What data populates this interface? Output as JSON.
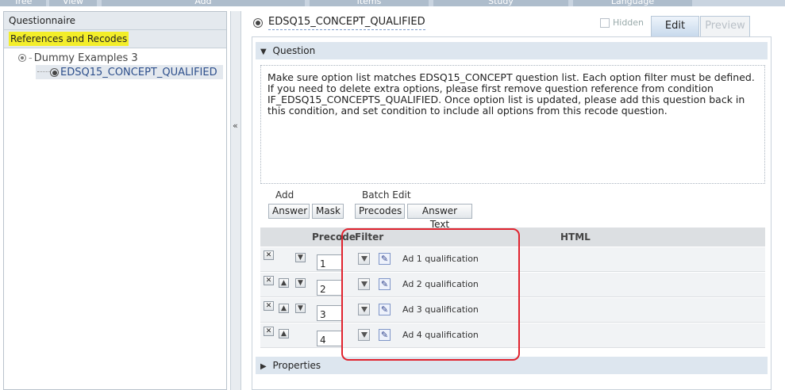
{
  "top_menu": [
    "Tree",
    "View",
    "Add",
    "Items",
    "Study",
    "Language"
  ],
  "left_panel": {
    "header": "Questionnaire",
    "references_header": "References and Recodes",
    "tree": {
      "root": "Dummy Examples 3",
      "child": "EDSQ15_CONCEPT_QUALIFIED"
    },
    "collapse_glyph": "«"
  },
  "editor": {
    "title": "EDSQ15_CONCEPT_QUALIFIED",
    "hidden_label": "Hidden",
    "tabs": {
      "edit": "Edit",
      "preview": "Preview"
    },
    "question_section": "Question",
    "question_text": "Make sure option list matches EDSQ15_CONCEPT question list. Each option filter must be defined. If you need to delete extra options, please first remove question reference from condition IF_EDSQ15_CONCEPTS_QUALIFIED. Once option list is updated, please add this question back in this condition, and set condition to include all options from this recode question.",
    "add_label": "Add",
    "batch_edit_label": "Batch Edit",
    "buttons": {
      "answer": "Answer",
      "mask": "Mask",
      "precodes": "Precodes",
      "answer_text": "Answer Text"
    },
    "grid_headers": {
      "precode": "Precode",
      "filter": "Filter",
      "html": "HTML"
    },
    "rows": [
      {
        "precode": "1",
        "html": "Ad 1 qualification"
      },
      {
        "precode": "2",
        "html": "Ad 2 qualification"
      },
      {
        "precode": "3",
        "html": "Ad 3 qualification"
      },
      {
        "precode": "4",
        "html": "Ad 4 qualification"
      }
    ],
    "properties_section": "Properties"
  },
  "annotation_color": "#e0232e",
  "highlight_color": "#f3ee2a"
}
